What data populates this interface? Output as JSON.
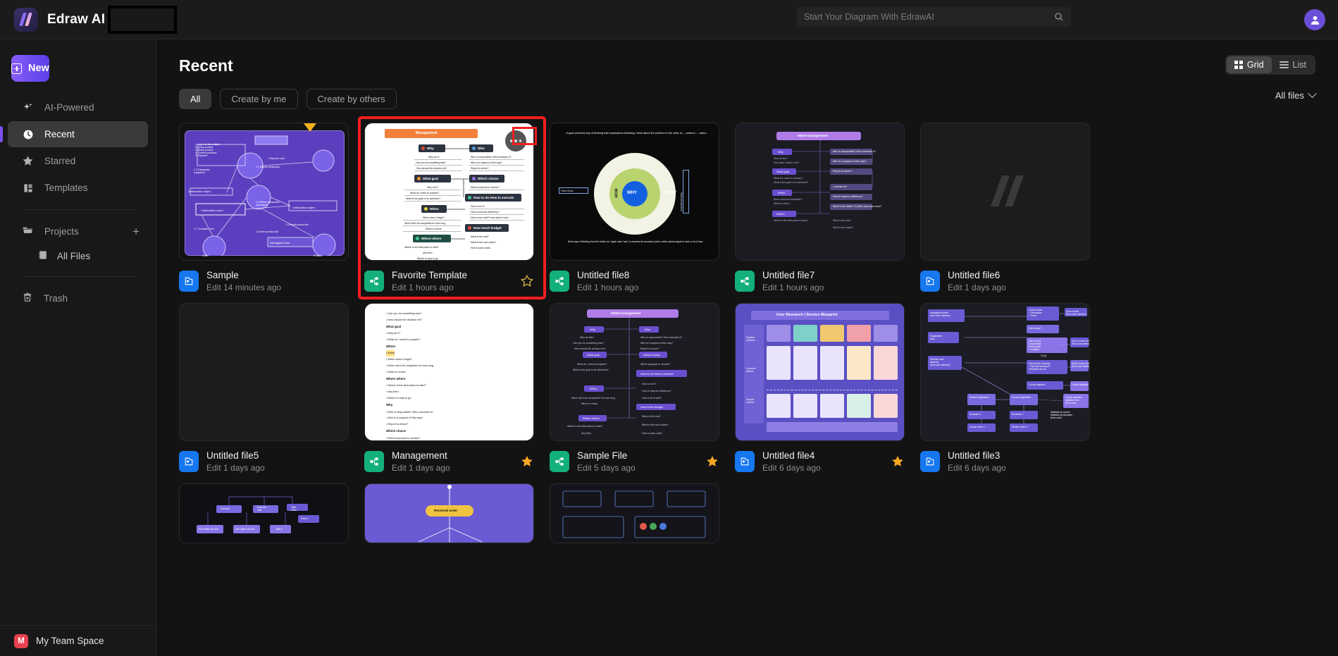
{
  "app": {
    "brand": "Edraw AI",
    "logo_icon": "edraw-logo-icon"
  },
  "search": {
    "placeholder": "Start Your Diagram With EdrawAI",
    "value": "",
    "icon": "search-icon"
  },
  "account": {
    "avatar_icon": "user-avatar-icon"
  },
  "sidebar": {
    "new_button": "New",
    "items": [
      {
        "label": "AI-Powered",
        "icon": "sparkle-icon",
        "active": false
      },
      {
        "label": "Recent",
        "icon": "clock-icon",
        "active": true
      },
      {
        "label": "Starred",
        "icon": "star-icon",
        "active": false
      },
      {
        "label": "Templates",
        "icon": "templates-icon",
        "active": false
      }
    ],
    "projects": {
      "label": "Projects",
      "icon": "folder-icon",
      "add_icon": "plus-icon"
    },
    "all_files": {
      "label": "All Files",
      "icon": "files-icon"
    },
    "trash": {
      "label": "Trash",
      "icon": "trash-icon"
    },
    "team_space": {
      "label": "My Team Space",
      "badge": "M",
      "badge_color": "#e8414e"
    }
  },
  "main": {
    "title": "Recent",
    "filters": [
      {
        "label": "All",
        "active": true
      },
      {
        "label": "Create by me",
        "active": false
      },
      {
        "label": "Create by others",
        "active": false
      }
    ],
    "view_toggle": [
      {
        "label": "Grid",
        "icon": "grid-icon",
        "active": true
      },
      {
        "label": "List",
        "icon": "list-icon",
        "active": false
      }
    ],
    "files_filter": {
      "label": "All files",
      "icon": "chevron-down-icon"
    }
  },
  "files": {
    "row1": [
      {
        "name": "Sample",
        "time": "Edit 14 minutes ago",
        "type_color": "blue",
        "starred": false,
        "highlighted": false
      },
      {
        "name": "Favorite Template",
        "time": "Edit 1 hours ago",
        "type_color": "green",
        "starred": false,
        "highlighted": true
      },
      {
        "name": "Untitled file8",
        "time": "Edit 1 hours ago",
        "type_color": "green",
        "starred": false,
        "highlighted": false
      },
      {
        "name": "Untitled file7",
        "time": "Edit 1 hours ago",
        "type_color": "green",
        "starred": false,
        "highlighted": false
      },
      {
        "name": "Untitled file6",
        "time": "Edit 1 days ago",
        "type_color": "blue",
        "starred": false,
        "highlighted": false
      }
    ],
    "row2": [
      {
        "name": "Untitled file5",
        "time": "Edit 1 days ago",
        "type_color": "blue",
        "starred": false,
        "highlighted": false
      },
      {
        "name": "Management",
        "time": "Edit 1 days ago",
        "type_color": "green",
        "starred": true,
        "highlighted": false
      },
      {
        "name": "Sample File",
        "time": "Edit 5 days ago",
        "type_color": "green",
        "starred": true,
        "highlighted": false
      },
      {
        "name": "Untitled file4",
        "time": "Edit 6 days ago",
        "type_color": "blue",
        "starred": true,
        "highlighted": false
      },
      {
        "name": "Untitled file3",
        "time": "Edit 6 days ago",
        "type_color": "blue",
        "starred": false,
        "highlighted": false
      }
    ]
  },
  "thumbnails": {
    "favorite_template": {
      "header": "Management",
      "nodes": [
        "Why",
        "Who",
        "What goal",
        "Which choice",
        "When",
        "How to do How to execute",
        "Where where",
        "How much budget"
      ],
      "sub_why": [
        "Why do it?",
        "Can you do something else?",
        "How should the decision be?"
      ],
      "sub_whatgoal": [
        "Why do it?",
        "What do I need to prepare?",
        "What is the goal to be achieved?"
      ],
      "sub_when": [
        "When does it begin?",
        "When will it be completed for how long",
        "When to check"
      ],
      "sub_who": [
        "Who is responsible? Who executes it?",
        "Who is a suspect of this way?",
        "Report to whom?"
      ],
      "sub_which": [
        "Which proposal to choose?"
      ],
      "sub_how": [
        "How to do it?",
        "How to improve efficiency?",
        "How to do it well? How does it work"
      ],
      "sub_budget": [
        "What is the cost?",
        "What is the cost output?",
        "How to save costs"
      ],
      "more_icon": "more-options-icon"
    },
    "untitled_file8": {
      "caption_top": "A goal-centered way of thinking that emphasizes following I think about the problem in the order of — method → action",
      "center": "WHY",
      "left": "HOW",
      "right": "WHAT",
      "side_left": "How does",
      "caption_bottom": "Both ways of thinking from the inside out, Apple uses \"why\" to express its resonance point, which causes Apple to have a lot of fans."
    },
    "untitled_file7": {
      "header": "6W2H management"
    },
    "sample_file": {
      "header": "6W2H management"
    },
    "untitled_file4": {
      "header": "User Research | Service Blueprint"
    },
    "untitled_file3": {
      "header": "management form (from user interface)"
    }
  },
  "colors": {
    "accent": "#7c4ff0",
    "highlight": "#f01f1f",
    "star_filled": "#f5a623",
    "file_blue": "#1677ef",
    "file_green": "#14b07a"
  }
}
